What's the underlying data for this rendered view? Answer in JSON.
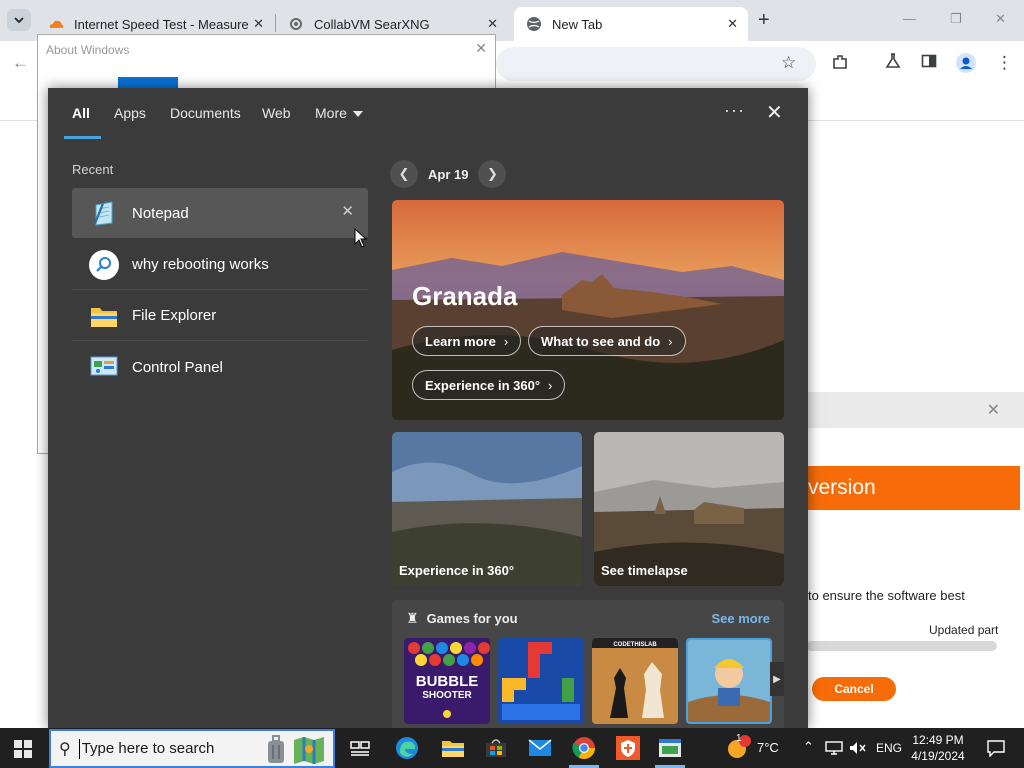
{
  "browser": {
    "tabs": [
      {
        "title": "Internet Speed Test - Measure"
      },
      {
        "title": "CollabVM SearXNG"
      },
      {
        "title": "New Tab"
      }
    ],
    "new_tab_symbol": "+"
  },
  "about_window": {
    "title": "About Windows"
  },
  "installer": {
    "heading": "version",
    "body_text": "to ensure the software best",
    "progress_label": "Updated part",
    "cancel_label": "Cancel"
  },
  "search": {
    "tabs": [
      {
        "label": "All"
      },
      {
        "label": "Apps"
      },
      {
        "label": "Documents"
      },
      {
        "label": "Web"
      },
      {
        "label": "More"
      }
    ],
    "recent_label": "Recent",
    "recent": [
      {
        "label": "Notepad"
      },
      {
        "label": "why rebooting works"
      },
      {
        "label": "File Explorer"
      },
      {
        "label": "Control Panel"
      }
    ],
    "date": "Apr 19",
    "hero": {
      "title": "Granada",
      "buttons": [
        "Learn more",
        "What to see and do",
        "Experience in 360°"
      ]
    },
    "cards": [
      {
        "label": "Experience in 360°"
      },
      {
        "label": "See timelapse"
      }
    ],
    "games": {
      "title": "Games for you",
      "see_more": "See more",
      "tiles": [
        "Bubble Shooter HD",
        "Block puzzle",
        "Chess",
        "Miner"
      ],
      "bubble_text_1": "BUBBLE",
      "bubble_text_2": "SHOOTER",
      "chess_badge": "CODETHISLAB"
    }
  },
  "taskbar": {
    "search_placeholder": "Type here to search",
    "weather": "7°C",
    "notification_count": "1",
    "language": "ENG",
    "time": "12:49 PM",
    "date": "4/19/2024"
  },
  "colors": {
    "search_panel_bg": "#3b3b3b",
    "accent": "#4aa3df",
    "link": "#78b7ea",
    "installer_orange": "#f86b09",
    "taskbar": "#202020"
  }
}
